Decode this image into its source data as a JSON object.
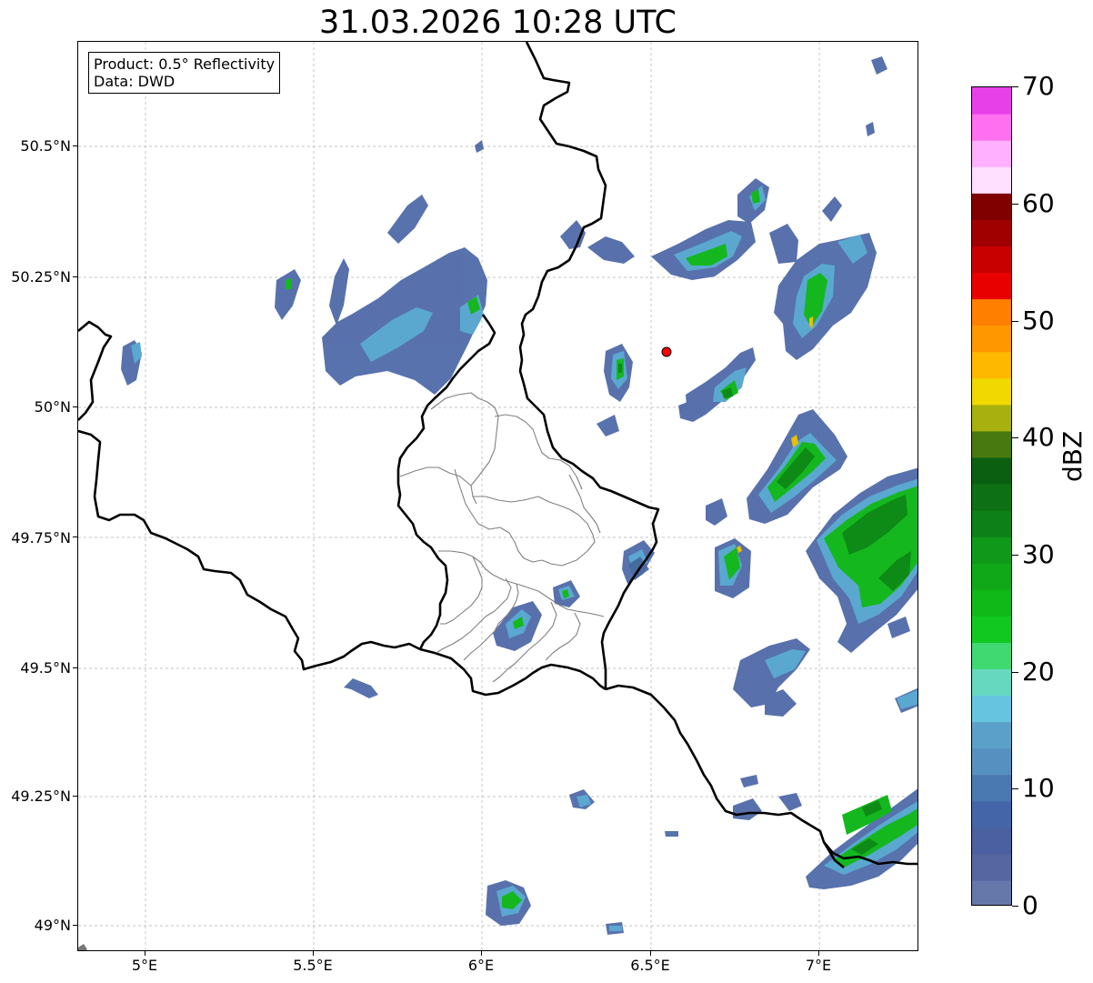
{
  "title": "31.03.2026 10:28 UTC",
  "info": {
    "product": "Product: 0.5° Reflectivity",
    "source": "Data: DWD"
  },
  "axes": {
    "lon_ticks": [
      "5°E",
      "5.5°E",
      "6°E",
      "6.5°E",
      "7°E"
    ],
    "lat_ticks": [
      "50.5°N",
      "50.25°N",
      "50°N",
      "49.75°N",
      "49.5°N",
      "49.25°N",
      "49°N"
    ],
    "lon_range": [
      4.8,
      7.3
    ],
    "lat_range": [
      48.95,
      50.7
    ],
    "gridlines": true
  },
  "radar_site": {
    "lon": 6.55,
    "lat": 50.11,
    "color": "#ff0000"
  },
  "colorbar": {
    "unit": "dBZ",
    "ticks": [
      "0",
      "10",
      "20",
      "30",
      "40",
      "50",
      "60",
      "70"
    ],
    "range": [
      0,
      70
    ],
    "step": 2.5,
    "colors": [
      "#6677aa",
      "#5566a0",
      "#4a60a0",
      "#4466a8",
      "#4a78b0",
      "#5590c0",
      "#5aa0c8",
      "#66c4e0",
      "#66d8c0",
      "#40d870",
      "#10c820",
      "#10b818",
      "#10a818",
      "#10981a",
      "#0e8018",
      "#0e7014",
      "#0a6010",
      "#487810",
      "#a8b010",
      "#f0d800",
      "#ffb800",
      "#ff9800",
      "#ff8000",
      "#e80000",
      "#c80000",
      "#a00000",
      "#800000",
      "#ffe0ff",
      "#ffb0ff",
      "#ff70f0",
      "#e840e8"
    ]
  },
  "echo_colors": {
    "weak": "#4a66a6",
    "light": "#5aa8d0",
    "cyan": "#5ad0c0",
    "green": "#14b81e",
    "dark_green": "#0e8a16",
    "yellow": "#e8c000"
  },
  "regions": {
    "border_color": "#000000",
    "district_color": "#808080"
  }
}
